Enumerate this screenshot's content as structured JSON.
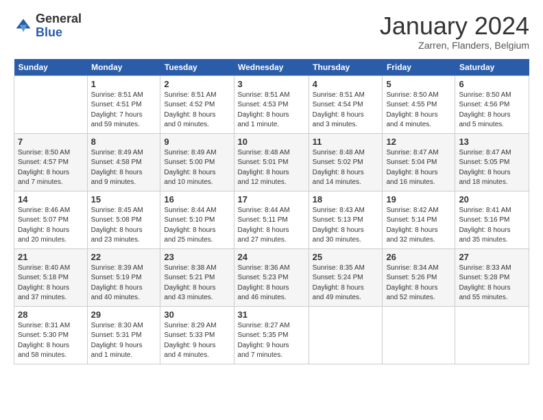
{
  "header": {
    "logo_line1": "General",
    "logo_line2": "Blue",
    "month": "January 2024",
    "location": "Zarren, Flanders, Belgium"
  },
  "weekdays": [
    "Sunday",
    "Monday",
    "Tuesday",
    "Wednesday",
    "Thursday",
    "Friday",
    "Saturday"
  ],
  "weeks": [
    [
      {
        "day": "",
        "info": ""
      },
      {
        "day": "1",
        "info": "Sunrise: 8:51 AM\nSunset: 4:51 PM\nDaylight: 7 hours\nand 59 minutes."
      },
      {
        "day": "2",
        "info": "Sunrise: 8:51 AM\nSunset: 4:52 PM\nDaylight: 8 hours\nand 0 minutes."
      },
      {
        "day": "3",
        "info": "Sunrise: 8:51 AM\nSunset: 4:53 PM\nDaylight: 8 hours\nand 1 minute."
      },
      {
        "day": "4",
        "info": "Sunrise: 8:51 AM\nSunset: 4:54 PM\nDaylight: 8 hours\nand 3 minutes."
      },
      {
        "day": "5",
        "info": "Sunrise: 8:50 AM\nSunset: 4:55 PM\nDaylight: 8 hours\nand 4 minutes."
      },
      {
        "day": "6",
        "info": "Sunrise: 8:50 AM\nSunset: 4:56 PM\nDaylight: 8 hours\nand 5 minutes."
      }
    ],
    [
      {
        "day": "7",
        "info": "Sunrise: 8:50 AM\nSunset: 4:57 PM\nDaylight: 8 hours\nand 7 minutes."
      },
      {
        "day": "8",
        "info": "Sunrise: 8:49 AM\nSunset: 4:58 PM\nDaylight: 8 hours\nand 9 minutes."
      },
      {
        "day": "9",
        "info": "Sunrise: 8:49 AM\nSunset: 5:00 PM\nDaylight: 8 hours\nand 10 minutes."
      },
      {
        "day": "10",
        "info": "Sunrise: 8:48 AM\nSunset: 5:01 PM\nDaylight: 8 hours\nand 12 minutes."
      },
      {
        "day": "11",
        "info": "Sunrise: 8:48 AM\nSunset: 5:02 PM\nDaylight: 8 hours\nand 14 minutes."
      },
      {
        "day": "12",
        "info": "Sunrise: 8:47 AM\nSunset: 5:04 PM\nDaylight: 8 hours\nand 16 minutes."
      },
      {
        "day": "13",
        "info": "Sunrise: 8:47 AM\nSunset: 5:05 PM\nDaylight: 8 hours\nand 18 minutes."
      }
    ],
    [
      {
        "day": "14",
        "info": "Sunrise: 8:46 AM\nSunset: 5:07 PM\nDaylight: 8 hours\nand 20 minutes."
      },
      {
        "day": "15",
        "info": "Sunrise: 8:45 AM\nSunset: 5:08 PM\nDaylight: 8 hours\nand 23 minutes."
      },
      {
        "day": "16",
        "info": "Sunrise: 8:44 AM\nSunset: 5:10 PM\nDaylight: 8 hours\nand 25 minutes."
      },
      {
        "day": "17",
        "info": "Sunrise: 8:44 AM\nSunset: 5:11 PM\nDaylight: 8 hours\nand 27 minutes."
      },
      {
        "day": "18",
        "info": "Sunrise: 8:43 AM\nSunset: 5:13 PM\nDaylight: 8 hours\nand 30 minutes."
      },
      {
        "day": "19",
        "info": "Sunrise: 8:42 AM\nSunset: 5:14 PM\nDaylight: 8 hours\nand 32 minutes."
      },
      {
        "day": "20",
        "info": "Sunrise: 8:41 AM\nSunset: 5:16 PM\nDaylight: 8 hours\nand 35 minutes."
      }
    ],
    [
      {
        "day": "21",
        "info": "Sunrise: 8:40 AM\nSunset: 5:18 PM\nDaylight: 8 hours\nand 37 minutes."
      },
      {
        "day": "22",
        "info": "Sunrise: 8:39 AM\nSunset: 5:19 PM\nDaylight: 8 hours\nand 40 minutes."
      },
      {
        "day": "23",
        "info": "Sunrise: 8:38 AM\nSunset: 5:21 PM\nDaylight: 8 hours\nand 43 minutes."
      },
      {
        "day": "24",
        "info": "Sunrise: 8:36 AM\nSunset: 5:23 PM\nDaylight: 8 hours\nand 46 minutes."
      },
      {
        "day": "25",
        "info": "Sunrise: 8:35 AM\nSunset: 5:24 PM\nDaylight: 8 hours\nand 49 minutes."
      },
      {
        "day": "26",
        "info": "Sunrise: 8:34 AM\nSunset: 5:26 PM\nDaylight: 8 hours\nand 52 minutes."
      },
      {
        "day": "27",
        "info": "Sunrise: 8:33 AM\nSunset: 5:28 PM\nDaylight: 8 hours\nand 55 minutes."
      }
    ],
    [
      {
        "day": "28",
        "info": "Sunrise: 8:31 AM\nSunset: 5:30 PM\nDaylight: 8 hours\nand 58 minutes."
      },
      {
        "day": "29",
        "info": "Sunrise: 8:30 AM\nSunset: 5:31 PM\nDaylight: 9 hours\nand 1 minute."
      },
      {
        "day": "30",
        "info": "Sunrise: 8:29 AM\nSunset: 5:33 PM\nDaylight: 9 hours\nand 4 minutes."
      },
      {
        "day": "31",
        "info": "Sunrise: 8:27 AM\nSunset: 5:35 PM\nDaylight: 9 hours\nand 7 minutes."
      },
      {
        "day": "",
        "info": ""
      },
      {
        "day": "",
        "info": ""
      },
      {
        "day": "",
        "info": ""
      }
    ]
  ]
}
